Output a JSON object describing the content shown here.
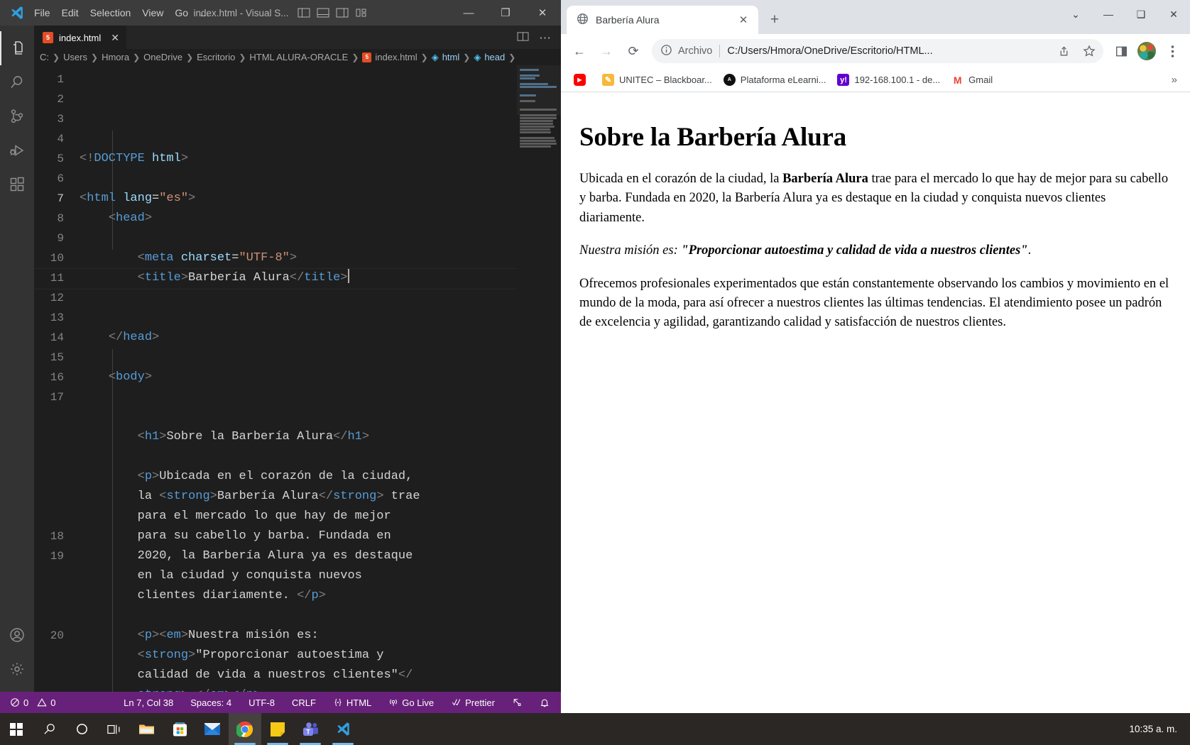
{
  "vscode": {
    "menus": [
      "File",
      "Edit",
      "Selection",
      "View",
      "Go",
      "…"
    ],
    "window_title": "index.html - Visual S...",
    "window_buttons": {
      "minimize": "—",
      "maximize": "❐",
      "close": "✕"
    },
    "layout_icons": [
      "toggle-primary-sidebar-icon",
      "toggle-panel-icon",
      "toggle-secondary-sidebar-icon",
      "customize-layout-icon"
    ],
    "activity_bar": [
      {
        "name": "explorer",
        "label": "Explorer"
      },
      {
        "name": "search",
        "label": "Search"
      },
      {
        "name": "source-control",
        "label": "Source Control"
      },
      {
        "name": "run-and-debug",
        "label": "Run and Debug"
      },
      {
        "name": "extensions",
        "label": "Extensions"
      },
      {
        "name": "accounts",
        "label": "Accounts"
      },
      {
        "name": "manage",
        "label": "Manage"
      }
    ],
    "tab": {
      "label": "index.html",
      "icon": "html5-icon",
      "close": "✕"
    },
    "tab_actions": [
      "split-editor-icon",
      "more-actions-icon"
    ],
    "breadcrumb": [
      "C:",
      "Users",
      "Hmora",
      "OneDrive",
      "Escritorio",
      "HTML ALURA-ORACLE",
      "index.html",
      "html",
      "head"
    ],
    "line_numbers": [
      "1",
      "2",
      "3",
      "4",
      "5",
      "6",
      "7",
      "8",
      "9",
      "10",
      "11",
      "12",
      "13",
      "14",
      "15",
      "16",
      "17",
      "18",
      "19",
      "20"
    ],
    "code_lines": [
      {
        "n": "1",
        "html": "<span class=\"tagbr\">&lt;!</span><span class=\"doct\">DOCTYPE</span> <span class=\"attr\">html</span><span class=\"tagbr\">&gt;</span>"
      },
      {
        "n": "2",
        "html": ""
      },
      {
        "n": "3",
        "html": "<span class=\"tagbr\">&lt;</span><span class=\"tagb\">html</span> <span class=\"attr\">lang</span><span class=\"txt\">=</span><span class=\"str\">\"es\"</span><span class=\"tagbr\">&gt;</span>"
      },
      {
        "n": "4",
        "html": "    <span class=\"tagbr\">&lt;</span><span class=\"tagb\">head</span><span class=\"tagbr\">&gt;</span>"
      },
      {
        "n": "5",
        "html": ""
      },
      {
        "n": "6",
        "html": "        <span class=\"tagbr\">&lt;</span><span class=\"tagb\">meta</span> <span class=\"attr\">charset</span><span class=\"txt\">=</span><span class=\"str\">\"UTF-8\"</span><span class=\"tagbr\">&gt;</span>"
      },
      {
        "n": "7",
        "html": "        <span class=\"tagbr\">&lt;</span><span class=\"tagb\">title</span><span class=\"tagbr\">&gt;</span><span class=\"txt\">Barbería Alura</span><span class=\"tagbr\">&lt;/</span><span class=\"tagb\">title</span><span class=\"tagbr\">&gt;</span>"
      },
      {
        "n": "8",
        "html": ""
      },
      {
        "n": "9",
        "html": ""
      },
      {
        "n": "10",
        "html": "    <span class=\"tagbr\">&lt;/</span><span class=\"tagb\">head</span><span class=\"tagbr\">&gt;</span>"
      },
      {
        "n": "11",
        "html": ""
      },
      {
        "n": "12",
        "html": "    <span class=\"tagbr\">&lt;</span><span class=\"tagb\">body</span><span class=\"tagbr\">&gt;</span>"
      },
      {
        "n": "13",
        "html": ""
      },
      {
        "n": "14",
        "html": ""
      },
      {
        "n": "15",
        "html": "        <span class=\"tagbr\">&lt;</span><span class=\"tagb\">h1</span><span class=\"tagbr\">&gt;</span><span class=\"txt\">Sobre la Barbería Alura</span><span class=\"tagbr\">&lt;/</span><span class=\"tagb\">h1</span><span class=\"tagbr\">&gt;</span>"
      },
      {
        "n": "16",
        "html": ""
      },
      {
        "n": "17",
        "html": "        <span class=\"tagbr\">&lt;</span><span class=\"tagb\">p</span><span class=\"tagbr\">&gt;</span><span class=\"txt\">Ubicada en el corazón de la ciudad,</span>"
      },
      {
        "n": "",
        "html": "        <span class=\"txt\">la </span><span class=\"tagbr\">&lt;</span><span class=\"tagb\">strong</span><span class=\"tagbr\">&gt;</span><span class=\"txt\">Barbería Alura</span><span class=\"tagbr\">&lt;/</span><span class=\"tagb\">strong</span><span class=\"tagbr\">&gt;</span><span class=\"txt\"> trae</span>"
      },
      {
        "n": "",
        "html": "        <span class=\"txt\">para el mercado lo que hay de mejor</span>"
      },
      {
        "n": "",
        "html": "        <span class=\"txt\">para su cabello y barba. Fundada en</span>"
      },
      {
        "n": "",
        "html": "        <span class=\"txt\">2020, la Barbería Alura ya es destaque</span>"
      },
      {
        "n": "",
        "html": "        <span class=\"txt\">en la ciudad y conquista nuevos</span>"
      },
      {
        "n": "",
        "html": "        <span class=\"txt\">clientes diariamente. </span><span class=\"tagbr\">&lt;/</span><span class=\"tagb\">p</span><span class=\"tagbr\">&gt;</span>"
      },
      {
        "n": "18",
        "html": ""
      },
      {
        "n": "19",
        "html": "        <span class=\"tagbr\">&lt;</span><span class=\"tagb\">p</span><span class=\"tagbr\">&gt;&lt;</span><span class=\"tagb\">em</span><span class=\"tagbr\">&gt;</span><span class=\"txt\">Nuestra misión es:</span>"
      },
      {
        "n": "",
        "html": "        <span class=\"tagbr\">&lt;</span><span class=\"tagb\">strong</span><span class=\"tagbr\">&gt;</span><span class=\"txt\">\"Proporcionar autoestima y</span>"
      },
      {
        "n": "",
        "html": "        <span class=\"txt\">calidad de vida a nuestros clientes\"</span><span class=\"tagbr\">&lt;/</span>"
      },
      {
        "n": "",
        "html": "        <span class=\"tagb\">strong</span><span class=\"tagbr\">&gt;</span><span class=\"txt\">.</span><span class=\"tagbr\">&lt;/</span><span class=\"tagb\">em</span><span class=\"tagbr\">&gt;&lt;/</span><span class=\"tagb\">p</span><span class=\"tagbr\">&gt;</span>"
      },
      {
        "n": "20",
        "html": ""
      }
    ],
    "status_bar": {
      "errors": "0",
      "warnings": "0",
      "cursor_position": "Ln 7, Col 38",
      "indentation": "Spaces: 4",
      "encoding": "UTF-8",
      "eol": "CRLF",
      "language": "HTML",
      "go_live": "Go Live",
      "prettier": "Prettier",
      "remote_icon": "remote-window-icon",
      "bell_icon": "notifications-bell-icon",
      "background_color": "#68217a"
    }
  },
  "chrome": {
    "tab": {
      "title": "Barbería Alura",
      "favicon": "globe-icon",
      "close": "✕"
    },
    "new_tab_label": "+",
    "window_controls": {
      "tab_search": "⌄",
      "minimize": "—",
      "maximize": "❑",
      "close": "✕"
    },
    "nav": {
      "back": "←",
      "forward": "→",
      "reload": "⟳"
    },
    "omnibox": {
      "info_icon": "info-circle-icon",
      "scheme_label": "Archivo",
      "url": "C:/Users/Hmora/OneDrive/Escritorio/HTML...",
      "share_icon": "share-icon",
      "bookmark_icon": "star-icon"
    },
    "toolbar_icons": [
      "side-panel-icon",
      "profile-avatar",
      "chrome-menu-icon"
    ],
    "bookmarks": [
      {
        "label": "",
        "icon": "youtube-icon",
        "color": "#ff0000"
      },
      {
        "label": "UNITEC – Blackboar...",
        "icon": "pencil-icon",
        "color": "#f6b93b"
      },
      {
        "label": "Plataforma eLearni...",
        "icon": "circle-icon",
        "color": "#111111"
      },
      {
        "label": "192-168.100.1 - de...",
        "icon": "yahoo-icon",
        "color": "#6001d2"
      },
      {
        "label": "Gmail",
        "icon": "gmail-icon",
        "color": "#ea4335"
      }
    ],
    "bookmarks_overflow": "»",
    "page": {
      "heading": "Sobre la Barbería Alura",
      "paragraph1_part1": "Ubicada en el corazón de la ciudad, la ",
      "paragraph1_strong": "Barbería Alura",
      "paragraph1_part2": " trae para el mercado lo que hay de mejor para su cabello y barba. Fundada en 2020, la Barbería Alura ya es destaque en la ciudad y conquista nuevos clientes diariamente.",
      "paragraph2_em": "Nuestra misión es: ",
      "paragraph2_strong": "\"Proporcionar autoestima y calidad de vida a nuestros clientes\"",
      "paragraph2_end": ".",
      "paragraph3": "Ofrecemos profesionales experimentados que están constantemente observando los cambios y movimiento en el mundo de la moda, para así ofrecer a nuestros clientes las últimas tendencias. El atendimiento posee un padrón de excelencia y agilidad, garantizando calidad y satisfacción de nuestros clientes."
    }
  },
  "taskbar": {
    "items": [
      {
        "name": "start-button",
        "icon": "windows-logo-icon"
      },
      {
        "name": "search-button",
        "icon": "search-icon"
      },
      {
        "name": "cortana-button",
        "icon": "circle-icon"
      },
      {
        "name": "task-view-button",
        "icon": "task-view-icon"
      },
      {
        "name": "file-explorer",
        "icon": "folder-icon"
      },
      {
        "name": "microsoft-store",
        "icon": "store-icon"
      },
      {
        "name": "mail",
        "icon": "mail-icon"
      },
      {
        "name": "google-chrome",
        "icon": "chrome-icon"
      },
      {
        "name": "sticky-notes",
        "icon": "sticky-note-icon"
      },
      {
        "name": "microsoft-teams",
        "icon": "teams-icon"
      },
      {
        "name": "visual-studio-code",
        "icon": "vscode-icon"
      }
    ],
    "clock": "10:35 a. m."
  }
}
